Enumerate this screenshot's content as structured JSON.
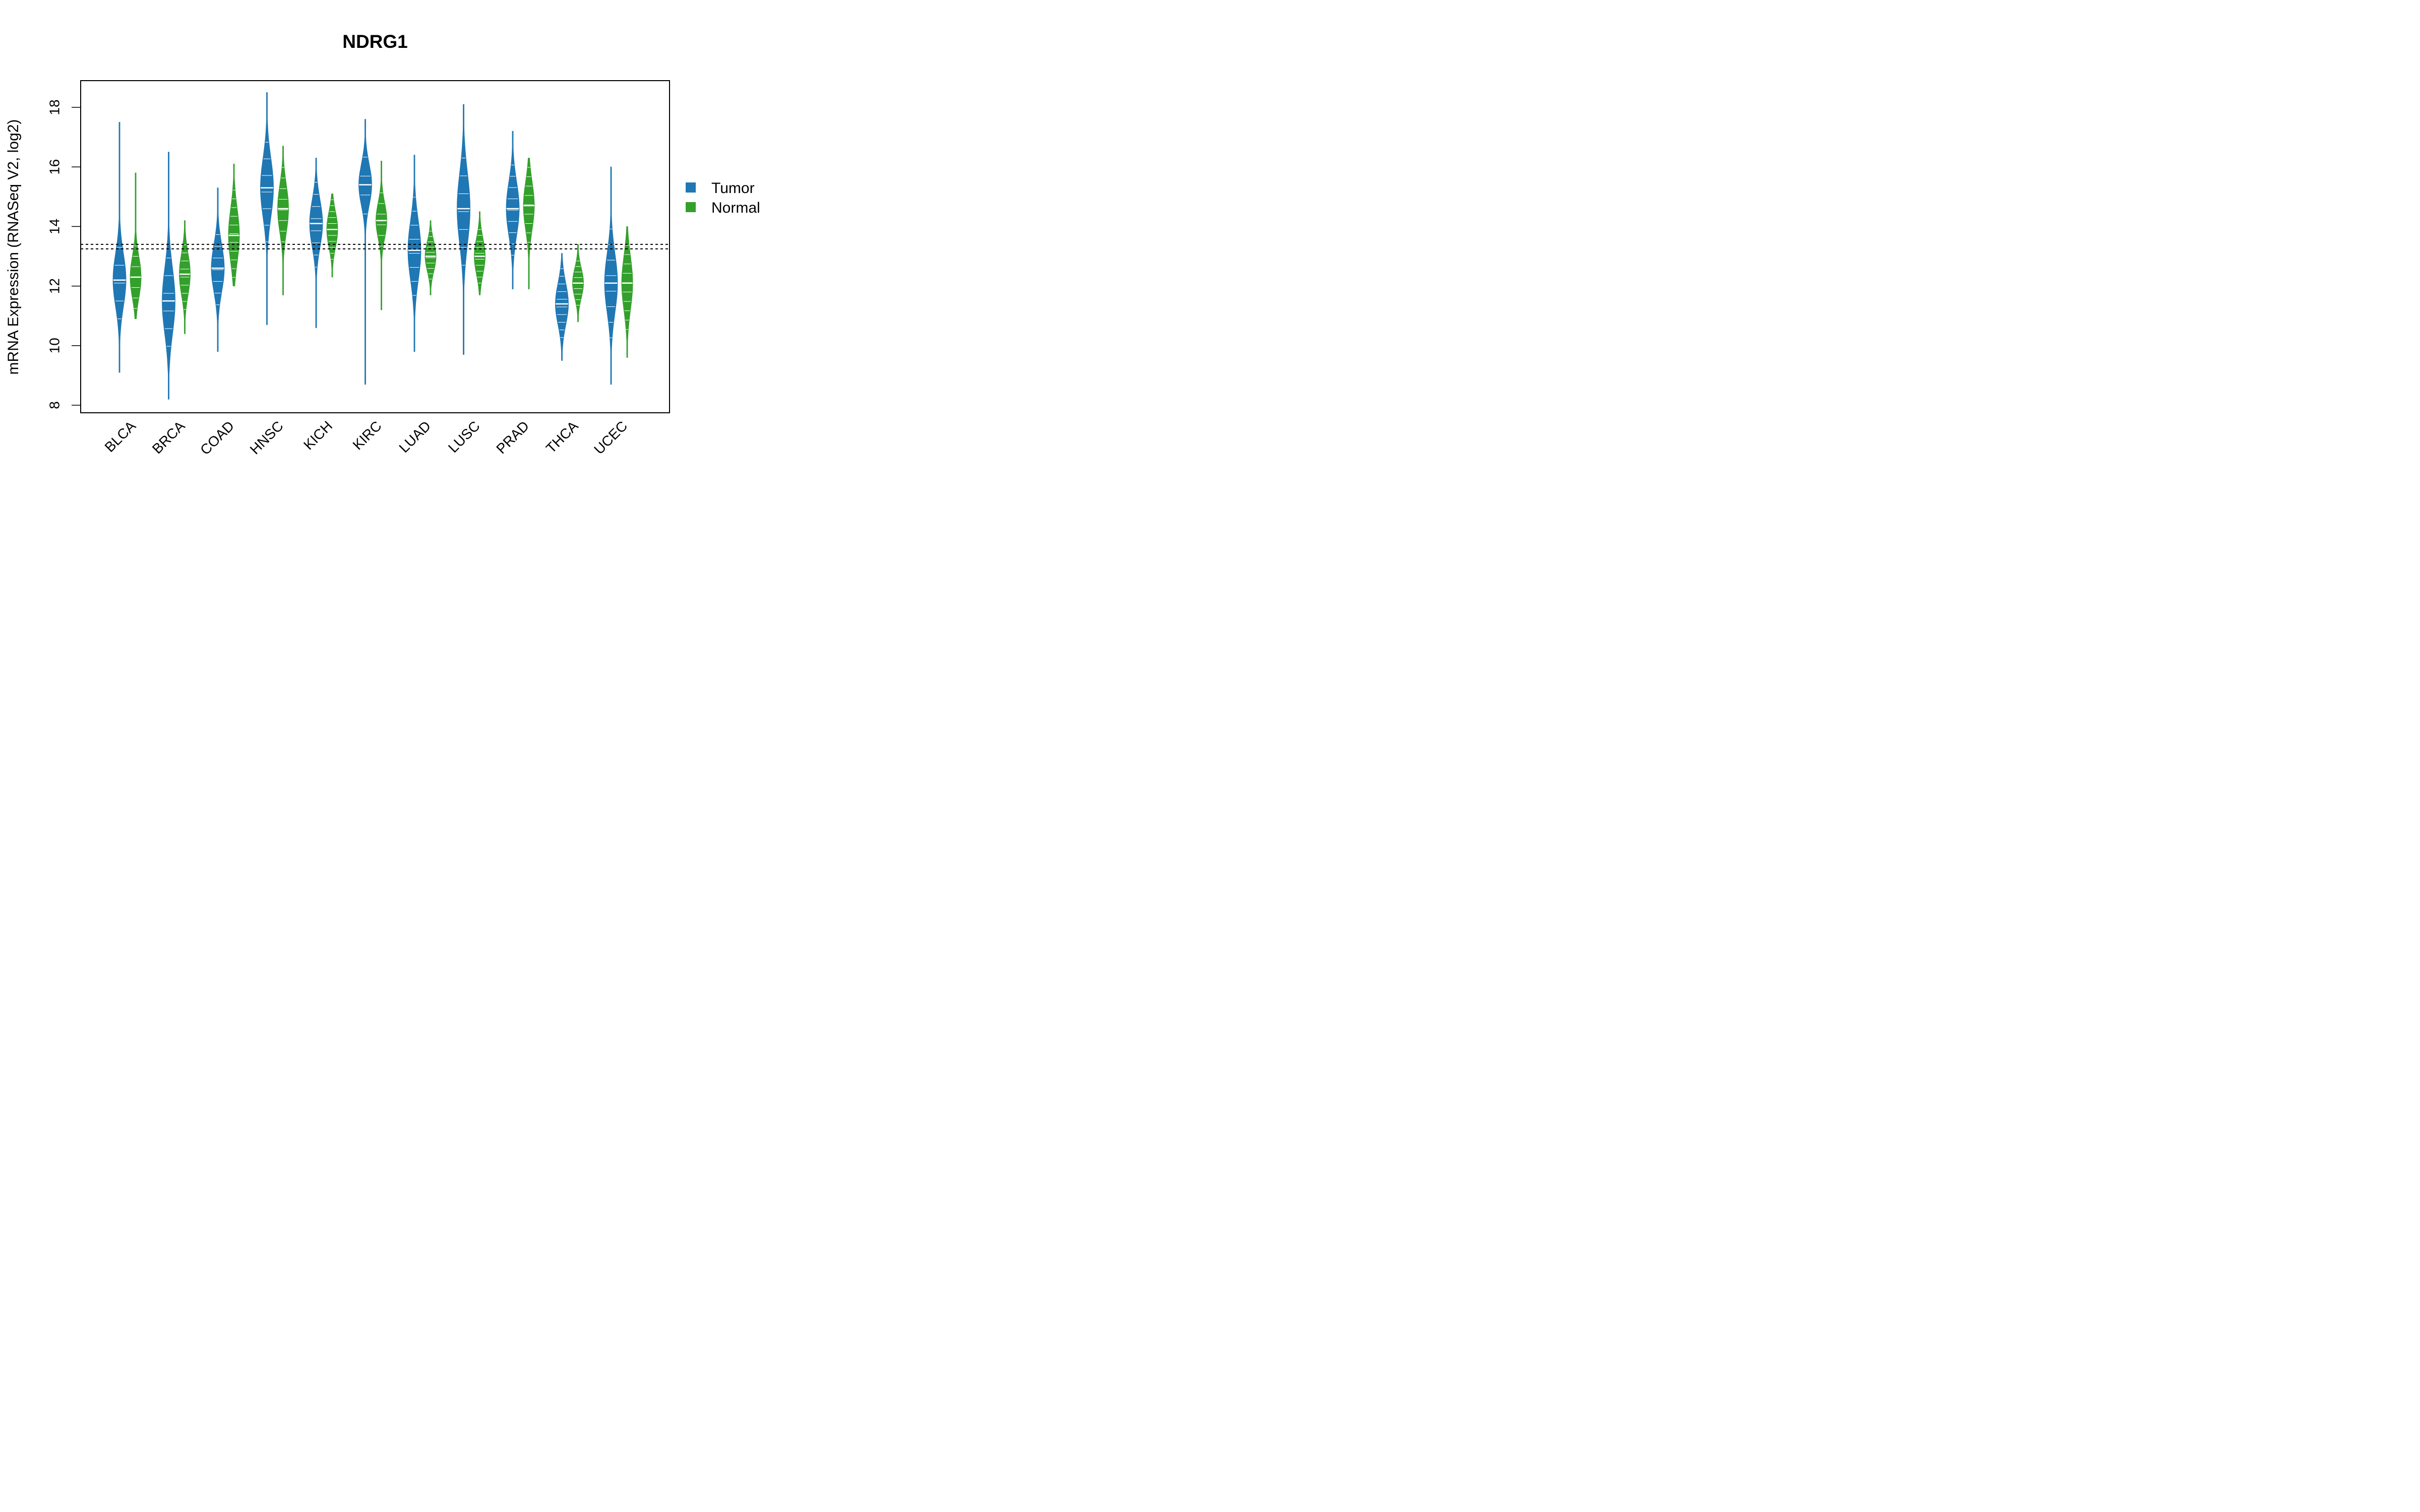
{
  "chart_data": {
    "type": "violin",
    "title": "NDRG1",
    "xlabel": "",
    "ylabel": "mRNA Expression (RNASeq V2, log2)",
    "ylim": [
      7.8,
      18.9
    ],
    "yticks": [
      8,
      10,
      12,
      14,
      16,
      18
    ],
    "grid": false,
    "legend_position": "right",
    "reference_lines": [
      13.4,
      13.25
    ],
    "categories": [
      "BLCA",
      "BRCA",
      "COAD",
      "HNSC",
      "KICH",
      "KIRC",
      "LUAD",
      "LUSC",
      "PRAD",
      "THCA",
      "UCEC"
    ],
    "series": [
      {
        "name": "Tumor",
        "color": "#1F77B4",
        "min": [
          9.1,
          8.2,
          9.8,
          10.7,
          10.6,
          8.7,
          9.8,
          9.7,
          11.9,
          9.5,
          8.7
        ],
        "median": [
          12.2,
          11.5,
          12.6,
          15.3,
          14.1,
          15.4,
          13.2,
          14.6,
          14.6,
          11.4,
          12.1
        ],
        "max": [
          17.5,
          16.5,
          15.3,
          18.5,
          16.3,
          17.6,
          16.4,
          18.1,
          17.2,
          13.1,
          16.0
        ],
        "spread": [
          0.9,
          1.1,
          0.8,
          1.0,
          0.8,
          0.7,
          1.0,
          1.2,
          0.9,
          0.7,
          1.0
        ]
      },
      {
        "name": "Normal",
        "color": "#33A02C",
        "min": [
          10.9,
          10.4,
          12.0,
          11.7,
          12.3,
          11.2,
          11.7,
          11.7,
          11.9,
          10.8,
          9.6
        ],
        "median": [
          12.3,
          12.4,
          13.7,
          14.6,
          13.9,
          14.2,
          13.0,
          13.0,
          14.7,
          12.1,
          12.1
        ],
        "max": [
          15.8,
          14.2,
          16.1,
          16.7,
          15.1,
          16.2,
          14.2,
          14.5,
          16.3,
          13.4,
          14.0
        ],
        "spread": [
          0.7,
          0.7,
          0.9,
          0.8,
          0.6,
          0.6,
          0.5,
          0.6,
          0.8,
          0.5,
          0.9
        ]
      }
    ]
  }
}
